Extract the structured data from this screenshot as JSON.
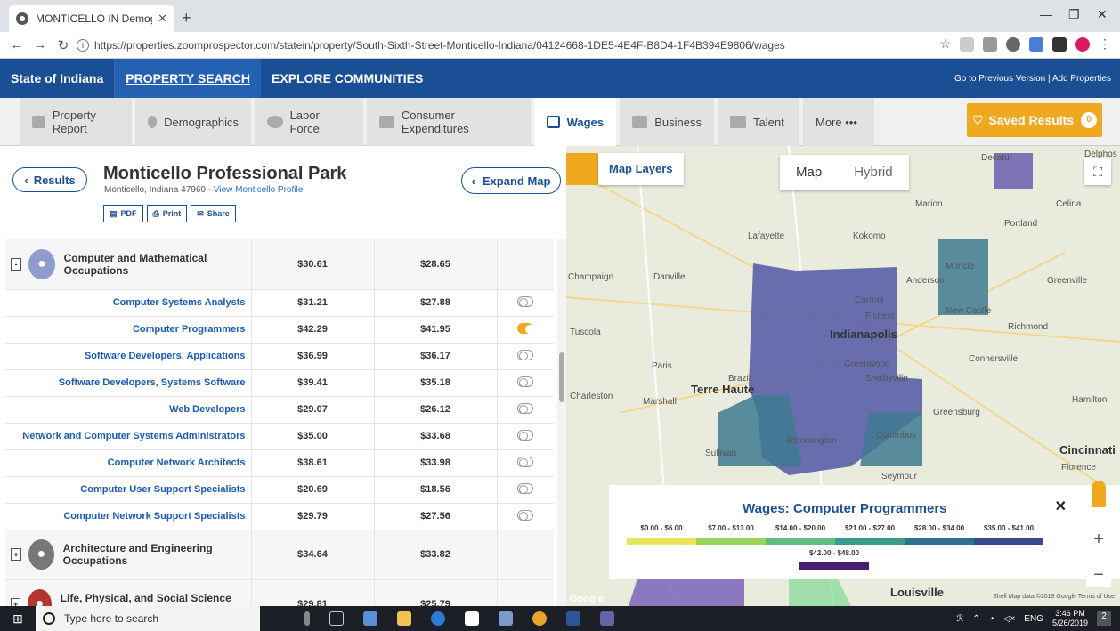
{
  "browser": {
    "tab_title": "MONTICELLO IN Demographics",
    "url": "https://properties.zoomprospector.com/statein/property/South-Sixth-Street-Monticello-Indiana/04124668-1DE5-4E4F-B8D4-1F4B394E9806/wages"
  },
  "nav": {
    "state": "State of Indiana",
    "property_search": "PROPERTY SEARCH",
    "explore": "EXPLORE COMMUNITIES",
    "right_links": "Go to Previous Version  |  Add Properties"
  },
  "tabs": [
    {
      "label": "Property Report"
    },
    {
      "label": "Demographics"
    },
    {
      "label": "Labor Force"
    },
    {
      "label": "Consumer Expenditures"
    },
    {
      "label": "Wages"
    },
    {
      "label": "Business"
    },
    {
      "label": "Talent"
    },
    {
      "label": "More •••"
    }
  ],
  "saved": {
    "label": "Saved Results",
    "count": "0"
  },
  "property": {
    "results_label": "Results",
    "title": "Monticello Professional Park",
    "address": "Monticello, Indiana 47960 - ",
    "profile_link": "View Monticello Profile",
    "pdf": "PDF",
    "print": "Print",
    "share": "Share",
    "expand_map": "Expand Map"
  },
  "rows": [
    {
      "type": "group",
      "name": "Computer and Mathematical Occupations",
      "v1": "$30.61",
      "v2": "$28.65",
      "expand": "-",
      "color": "#8f9ccc"
    },
    {
      "type": "item",
      "name": "Computer Systems Analysts",
      "v1": "$31.21",
      "v2": "$27.88",
      "on": false
    },
    {
      "type": "item",
      "name": "Computer Programmers",
      "v1": "$42.29",
      "v2": "$41.95",
      "on": true
    },
    {
      "type": "item",
      "name": "Software Developers, Applications",
      "v1": "$36.99",
      "v2": "$36.17",
      "on": false
    },
    {
      "type": "item",
      "name": "Software Developers, Systems Software",
      "v1": "$39.41",
      "v2": "$35.18",
      "on": false
    },
    {
      "type": "item",
      "name": "Web Developers",
      "v1": "$29.07",
      "v2": "$26.12",
      "on": false
    },
    {
      "type": "item",
      "name": "Network and Computer Systems Administrators",
      "v1": "$35.00",
      "v2": "$33.68",
      "on": false
    },
    {
      "type": "item",
      "name": "Computer Network Architects",
      "v1": "$38.61",
      "v2": "$33.98",
      "on": false
    },
    {
      "type": "item",
      "name": "Computer User Support Specialists",
      "v1": "$20.69",
      "v2": "$18.56",
      "on": false
    },
    {
      "type": "item",
      "name": "Computer Network Support Specialists",
      "v1": "$29.79",
      "v2": "$27.56",
      "on": false
    },
    {
      "type": "group",
      "name": "Architecture and Engineering Occupations",
      "v1": "$34.64",
      "v2": "$33.82",
      "expand": "+",
      "color": "#777777"
    },
    {
      "type": "group",
      "name": "Life, Physical, and Social Science Occupations",
      "v1": "$29.81",
      "v2": "$25.79",
      "expand": "+",
      "color": "#b5362f"
    }
  ],
  "map": {
    "layers_label": "Map Layers",
    "map_label": "Map",
    "hybrid_label": "Hybrid",
    "legend_title": "Wages: Computer Programmers",
    "legend": [
      {
        "label": "$0.00 - $6.00",
        "color": "#e8e65a"
      },
      {
        "label": "$7.00 - $13.00",
        "color": "#9cd35e"
      },
      {
        "label": "$14.00 - $20.00",
        "color": "#5fbf7d"
      },
      {
        "label": "$21.00 - $27.00",
        "color": "#3e9a8f"
      },
      {
        "label": "$28.00 - $34.00",
        "color": "#2f6f8f"
      },
      {
        "label": "$35.00 - $41.00",
        "color": "#3b4a8c"
      },
      {
        "label": "$42.00 - $48.00",
        "color": "#4b1f6f"
      }
    ],
    "labels": [
      "Decatur",
      "Delphos",
      "Lafayette",
      "Kokomo",
      "Marion",
      "Celina",
      "Portland",
      "Champaign",
      "Danville",
      "Muncie",
      "Anderson",
      "Greenville",
      "Tuscola",
      "Carmel",
      "Fishers",
      "Indianapolis",
      "New Castle",
      "Richmond",
      "Paris",
      "Terre Haute",
      "Brazil",
      "Greenwood",
      "Shelbyville",
      "Connersville",
      "Charleston",
      "Marshall",
      "Greensburg",
      "Hamilton",
      "Bloomington",
      "Columbus",
      "Sullivan",
      "Cincinnati",
      "Florence",
      "Seymour",
      "Louisville"
    ],
    "footer": "Shell  Map data ©2019 Google   Terms of Use",
    "google": "Google"
  },
  "taskbar": {
    "search": "Type here to search",
    "lang": "ENG",
    "time": "3:46 PM",
    "date": "5/26/2019"
  }
}
